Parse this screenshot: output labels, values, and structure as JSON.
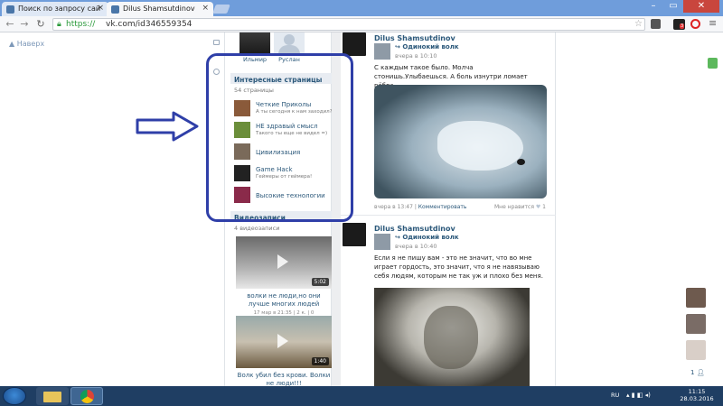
{
  "browser": {
    "tabs": [
      {
        "title": "Поиск по запросу сай",
        "favicon_color": "#4a76a8"
      },
      {
        "title": "Dilus Shamsutdinov",
        "favicon_color": "#4a76a8"
      }
    ],
    "url_scheme": "https://",
    "url_rest": "vk.com/id346559354",
    "notif_badge": "3"
  },
  "left": {
    "back_label": "Наверх"
  },
  "friends": [
    {
      "name": "Ильмир"
    },
    {
      "name": "Руслан"
    }
  ],
  "interesting_pages": {
    "title": "Интересные страницы",
    "count": "54 страницы",
    "items": [
      {
        "name": "Четкие Приколы",
        "desc": "А ты сегодня к нам заходил?",
        "color": "#8a5a3a"
      },
      {
        "name": "НЕ здравый смысл",
        "desc": "Такого ты еще не видел =)",
        "color": "#6b8e3a"
      },
      {
        "name": "Цивилизация",
        "desc": "",
        "color": "#7a6a5a"
      },
      {
        "name": "Game Hack",
        "desc": "Геймеры от геймера!",
        "color": "#222222"
      },
      {
        "name": "Высокие технологии",
        "desc": "",
        "color": "#8a2a4a"
      }
    ]
  },
  "videos": {
    "title": "Видеозаписи",
    "count": "4 видеозаписи",
    "items": [
      {
        "title": "волки не люди,но они лучше многих людей",
        "meta": "17 мар в 21:35 | 2 к. | 0",
        "duration": "5:02"
      },
      {
        "title": "Волк убил без крови. Волки не люди!!!",
        "meta": "",
        "duration": "1:40"
      }
    ]
  },
  "posts": [
    {
      "author": "Dilus Shamsutdinov",
      "repost_from": "Одинокий волк",
      "repost_date": "вчера в 10:10",
      "text": "С каждым такое было. Молча стонишь.Улыбаешься. А боль изнутри ломает рёбра.",
      "footer_left": "вчера в 13:47",
      "footer_comment": "Комментировать",
      "footer_like": "Мне нравится",
      "like_count": "1"
    },
    {
      "author": "Dilus Shamsutdinov",
      "repost_from": "Одинокий волк",
      "repost_date": "вчера в 10:40",
      "text": "Если я не пишу вам - это не значит, что во мне играет гордость, это значит, что я не навязываю себя людям, которым не так уж и плохо без меня."
    }
  ],
  "chat": {
    "online_count": "1"
  },
  "taskbar": {
    "lang": "RU",
    "time": "11:15",
    "date": "28.03.2016"
  }
}
